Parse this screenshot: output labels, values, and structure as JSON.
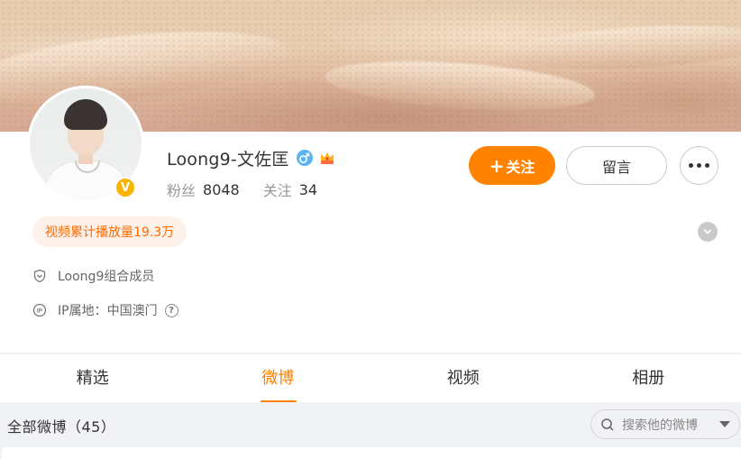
{
  "profile": {
    "name": "Loong9-文佐匡",
    "fans_label": "粉丝",
    "fans_count": "8048",
    "follow_label": "关注",
    "follow_count": "34",
    "verified_mark": "V",
    "gender_icon": "male-icon",
    "crown_icon": "crown-icon"
  },
  "actions": {
    "follow": "关注",
    "message": "留言",
    "more_icon": "more-icon"
  },
  "tag": {
    "text": "视频累计播放量19.3万"
  },
  "info": {
    "group": "Loong9组合成员",
    "ip": "IP属地：中国澳门"
  },
  "tabs": [
    {
      "label": "精选",
      "active": false
    },
    {
      "label": "微博",
      "active": true
    },
    {
      "label": "视频",
      "active": false
    },
    {
      "label": "相册",
      "active": false
    }
  ],
  "feed": {
    "count_text": "全部微博（45）",
    "search_placeholder": "搜索他的微博"
  },
  "colors": {
    "accent": "#ff8200",
    "tag_text": "#ff6a00",
    "tag_bg": "#fdf1ea",
    "badge": "#f7b500",
    "male": "#5ab3f2"
  }
}
